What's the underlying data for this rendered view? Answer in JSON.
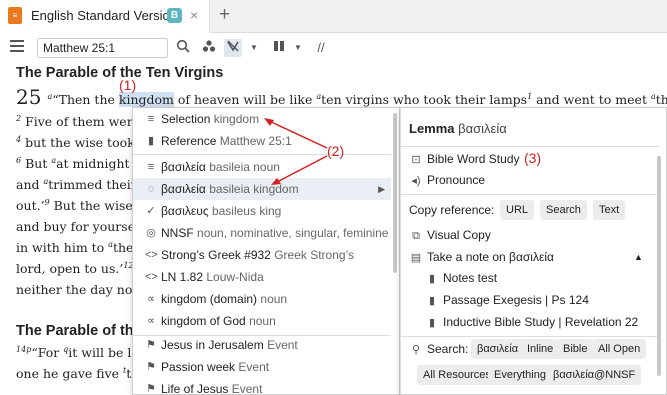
{
  "tab": {
    "title": "English Standard Version",
    "badge": "B",
    "close": "×",
    "add": "+"
  },
  "toolbar": {
    "reference": "Matthew 25:1"
  },
  "bible": {
    "heading1": "The Parable of the Ten Virgins",
    "chapter": "25",
    "v1_pre": "“Then the ",
    "v1_sel": "kingdom",
    "v1_mid": " of heaven will be like ",
    "v1_post": "ten virgins who took their lamps",
    "v1_end": " and went to meet ",
    "v1_tail": "the br",
    "line2": "Five of them were",
    "line3": "but the wise took",
    "line4a": "But ",
    "line4b": "at midnight",
    "line5a": "and ",
    "line5b": "trimmed their",
    "line6": "out.’",
    "line6b": " But the wise",
    "line7": "and buy for yourse",
    "line8a": "in with him to ",
    "line8b": "the",
    "line9": "lord, open to us.’",
    "line10": "neither the day nor",
    "heading2": "The Parable of th",
    "line11a": "“For ",
    "line11b": "it will be l",
    "line12": "one he gave five ",
    "line12b": "ta"
  },
  "annotations": {
    "a1": "(1)",
    "a2": "(2)",
    "a3": "(3)"
  },
  "left_menu": {
    "items": [
      {
        "icon": "≡",
        "label": "Selection",
        "sub": "kingdom"
      },
      {
        "icon": "▮",
        "label": "Reference",
        "sub": "Matthew 25:1"
      },
      {
        "icon": "≡",
        "label": "βασιλεία",
        "sub": "basileia noun"
      },
      {
        "icon": "◌",
        "label": "βασιλεία",
        "sub": "basileia kingdom"
      },
      {
        "icon": "✓",
        "label": "βασιλευς",
        "sub": "basileus king"
      },
      {
        "icon": "◎",
        "label": "NNSF",
        "sub": "noun, nominative, singular, feminine"
      },
      {
        "icon": "<>",
        "label": "Strong’s Greek #932",
        "sub": "Greek Strong’s"
      },
      {
        "icon": "<>",
        "label": "LN 1.82",
        "sub": "Louw-Nida"
      },
      {
        "icon": "∝",
        "label": "kingdom (domain)",
        "sub": "noun"
      },
      {
        "icon": "∝",
        "label": "kingdom of God",
        "sub": "noun"
      },
      {
        "icon": "⚑",
        "label": "Jesus in Jerusalem",
        "sub": "Event"
      },
      {
        "icon": "⚑",
        "label": "Passion week",
        "sub": "Event"
      },
      {
        "icon": "⚑",
        "label": "Life of Jesus",
        "sub": "Event"
      }
    ]
  },
  "right_menu": {
    "lemma_label": "Lemma",
    "lemma_value": "βασιλεία",
    "bible_word_study": "Bible Word Study",
    "pronounce": "Pronounce",
    "copy_reference": "Copy reference:",
    "copy_buttons": [
      "URL",
      "Search",
      "Text"
    ],
    "visual_copy": "Visual Copy",
    "take_note": "Take a note on βασιλεία",
    "notes": [
      "Notes test",
      "Passage Exegesis | Ps 124",
      "Inductive Bible Study | Revelation 22"
    ],
    "search_label": "Search:",
    "search_buttons_row1": [
      "βασιλεία",
      "Inline",
      "Bible",
      "All Open"
    ],
    "search_buttons_row2": [
      "All Resources",
      "Everything",
      "βασιλεία@NNSF"
    ]
  },
  "colors": {
    "accent": "#ea7a20",
    "badge": "#5db7c2",
    "annotation": "#d42020",
    "selection": "#cfe0f2"
  }
}
